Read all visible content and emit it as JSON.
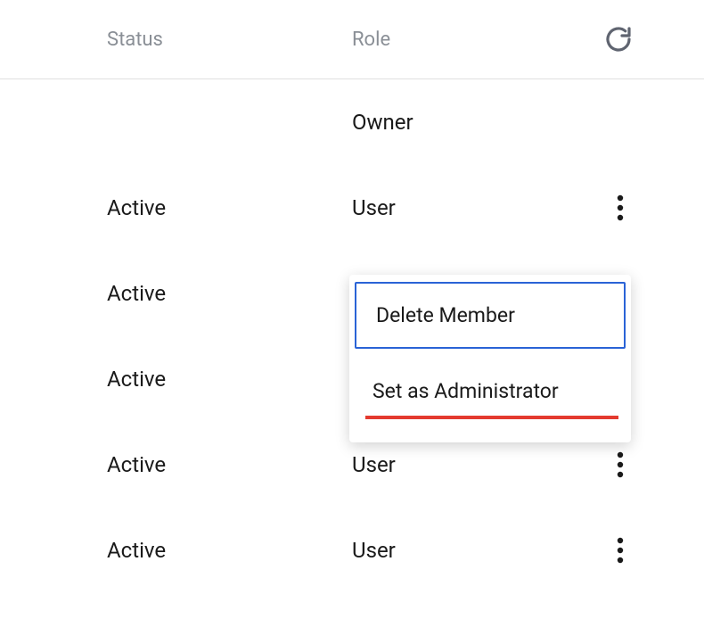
{
  "table": {
    "headers": {
      "status": "Status",
      "role": "Role"
    },
    "rows": [
      {
        "status": "",
        "role": "Owner",
        "hasActions": false
      },
      {
        "status": "Active",
        "role": "User",
        "hasActions": true
      },
      {
        "status": "Active",
        "role": "",
        "hasActions": false
      },
      {
        "status": "Active",
        "role": "",
        "hasActions": false
      },
      {
        "status": "Active",
        "role": "User",
        "hasActions": true
      },
      {
        "status": "Active",
        "role": "User",
        "hasActions": true
      }
    ]
  },
  "menu": {
    "items": [
      {
        "label": "Delete Member"
      },
      {
        "label": "Set as Administrator"
      }
    ]
  }
}
